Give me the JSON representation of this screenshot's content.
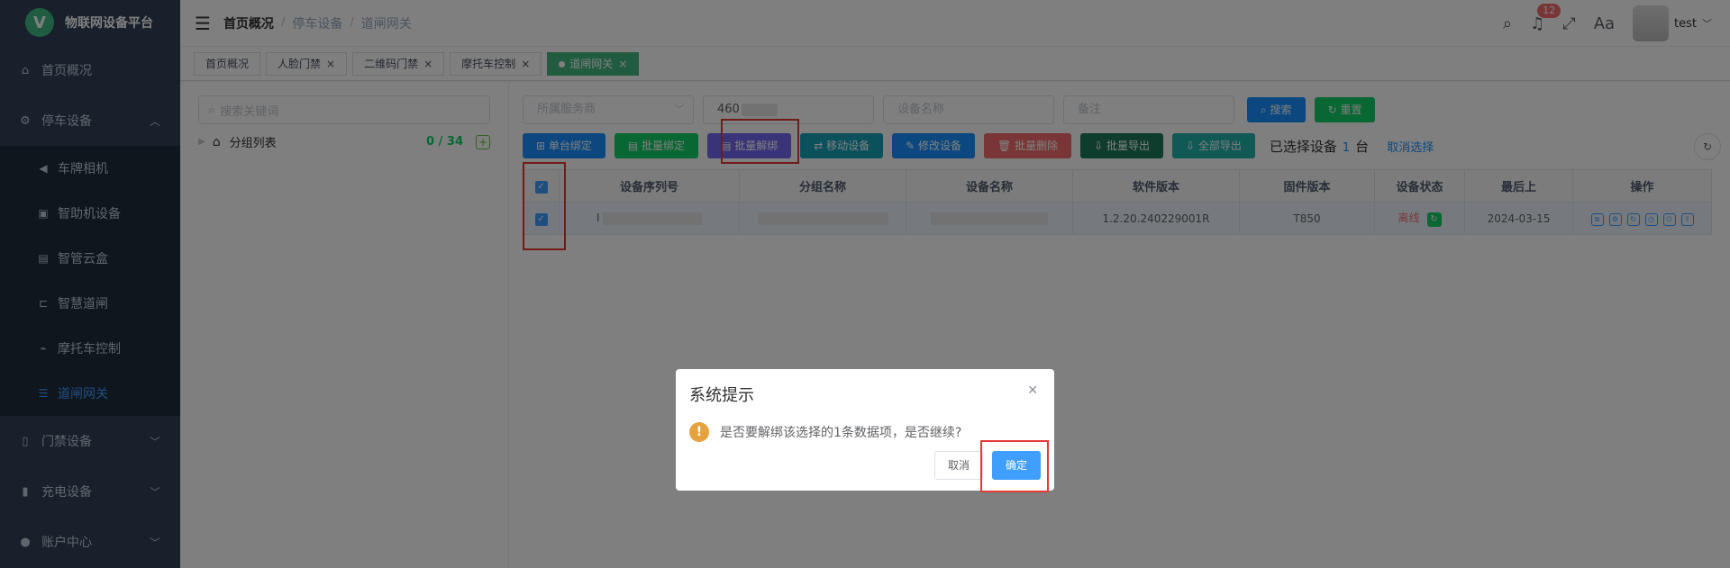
{
  "app": {
    "title": "物联网设备平台",
    "logo_letter": "V"
  },
  "sidebar": {
    "items": [
      {
        "label": "首页概况",
        "icon": "home-icon"
      },
      {
        "label": "停车设备",
        "icon": "car-icon"
      },
      {
        "label": "门禁设备",
        "icon": "door-icon"
      },
      {
        "label": "充电设备",
        "icon": "charge-icon"
      },
      {
        "label": "账户中心",
        "icon": "user-icon"
      }
    ],
    "sub_items": [
      {
        "label": "车牌相机",
        "icon": "camera-icon"
      },
      {
        "label": "智助机设备",
        "icon": "kiosk-icon"
      },
      {
        "label": "智管云盒",
        "icon": "box-icon"
      },
      {
        "label": "智慧道闸",
        "icon": "gate-icon"
      },
      {
        "label": "摩托车控制",
        "icon": "moto-icon"
      },
      {
        "label": "道闸网关",
        "icon": "gateway-icon"
      }
    ]
  },
  "header": {
    "breadcrumb": [
      "首页概况",
      "停车设备",
      "道闸网关"
    ],
    "notify_count": "12",
    "username": "test"
  },
  "tabs": [
    {
      "label": "首页概况"
    },
    {
      "label": "人脸门禁"
    },
    {
      "label": "二维码门禁"
    },
    {
      "label": "摩托车控制"
    },
    {
      "label": "道闸网关"
    }
  ],
  "tree": {
    "search_placeholder": "搜索关键词",
    "root_label": "分组列表",
    "count_online": "0",
    "count_total": "34"
  },
  "filters": {
    "service_placeholder": "所属服务商",
    "serial_value": "460",
    "name_placeholder": "设备名称",
    "remark_placeholder": "备注",
    "search_label": "搜索",
    "reset_label": "重置"
  },
  "toolbar": {
    "single_bind": "单台绑定",
    "batch_bind": "批量绑定",
    "batch_unbind": "批量解绑",
    "move_device": "移动设备",
    "edit_device": "修改设备",
    "batch_delete": "批量删除",
    "batch_export": "批量导出",
    "export_all": "全部导出",
    "selected_prefix": "已选择设备",
    "selected_count": "1",
    "selected_unit": "台",
    "cancel_select": "取消选择"
  },
  "table": {
    "headers": [
      "设备序列号",
      "分组名称",
      "设备名称",
      "软件版本",
      "固件版本",
      "设备状态",
      "最后上",
      "操作"
    ],
    "rows": [
      {
        "serial": "I",
        "software": "1.2.20.240229001R",
        "firmware": "T850",
        "status": "离线",
        "last_online": "2024-03-15"
      }
    ]
  },
  "dialog": {
    "title": "系统提示",
    "message": "是否要解绑该选择的1条数据项，是否继续?",
    "cancel_label": "取消",
    "confirm_label": "确定"
  },
  "colors": {
    "sidebar_bg": "#304156",
    "active": "#409eff",
    "tag_active": "#42b983",
    "highlight": "#e53935"
  }
}
